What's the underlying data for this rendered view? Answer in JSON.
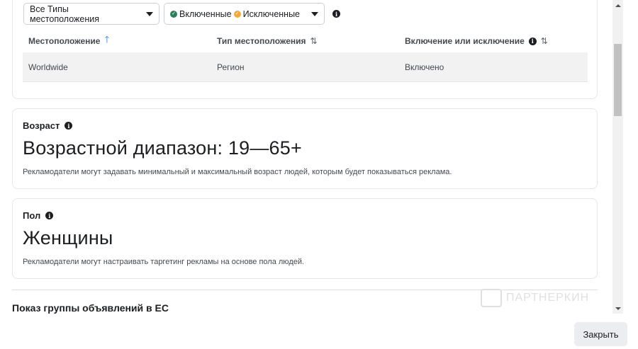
{
  "location_filter": {
    "types_dropdown": "Все Типы местоположения",
    "status_included": "Включенные",
    "status_excluded": "Исключенные"
  },
  "location_table": {
    "headers": {
      "location": "Местоположение",
      "type": "Тип местоположения",
      "inclusion": "Включение или исключение"
    },
    "rows": [
      {
        "location": "Worldwide",
        "type": "Регион",
        "inclusion": "Включено"
      }
    ]
  },
  "age": {
    "title": "Возраст",
    "value": "Возрастной диапазон: 19—65+",
    "description": "Рекламодатели могут задавать минимальный и максимальный возраст людей, которым будет показываться реклама."
  },
  "gender": {
    "title": "Пол",
    "value": "Женщины",
    "description": "Рекламодатели могут настраивать таргетинг рекламы на основе пола людей."
  },
  "eu_section": {
    "title": "Показ группы объявлений в ЕС"
  },
  "watermark": {
    "text": "ПАРТНЕРКИН"
  },
  "footer": {
    "close_label": "Закрыть"
  },
  "colors": {
    "sort_active": "#1877f2",
    "included_dot": "#2e7d5b",
    "excluded_dot": "#f0a93a"
  }
}
